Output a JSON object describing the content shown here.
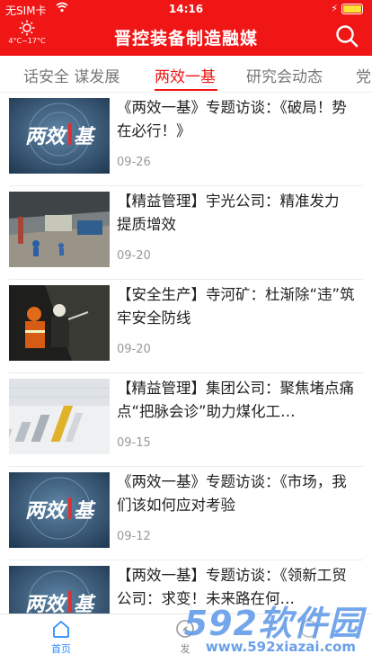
{
  "status_bar": {
    "carrier": "无SIM卡",
    "time": "14:16"
  },
  "header": {
    "weather_temp": "4°C~17°C",
    "title": "晋控装备制造融媒"
  },
  "tabs": [
    {
      "label": "话安全 谋发展"
    },
    {
      "label": "两效一基"
    },
    {
      "label": "研究会动态"
    },
    {
      "label": "党"
    }
  ],
  "active_tab": 1,
  "articles": [
    {
      "title": "《两效一基》专题访谈：《破局！势在必行！》",
      "date": "09-26",
      "thumb": "liangxiao-logo"
    },
    {
      "title": "【精益管理】宇光公司：精准发力 提质增效",
      "date": "09-20",
      "thumb": "factory"
    },
    {
      "title": "【安全生产】寺河矿：杜渐除“违”筑牢安全防线",
      "date": "09-20",
      "thumb": "miners"
    },
    {
      "title": "【精益管理】集团公司：聚焦堵点痛点“把脉会诊”助力煤化工…",
      "date": "09-15",
      "thumb": "chart"
    },
    {
      "title": "《两效一基》专题访谈：《市场，我们该如何应对考验",
      "date": "09-12",
      "thumb": "liangxiao-logo"
    },
    {
      "title": "【两效一基】专题访谈：《领新工贸公司：求变！未来路在何…",
      "date": "",
      "thumb": "liangxiao-logo"
    }
  ],
  "bottom_nav": [
    {
      "label": "首页",
      "icon": "home-icon"
    },
    {
      "label": "发",
      "icon": "discover-icon"
    }
  ],
  "watermark": {
    "logo": "592软件园",
    "url": "www.592xiazai.com"
  },
  "colors": {
    "brand_red": "#f01616",
    "active_blue": "#2b8cff"
  }
}
